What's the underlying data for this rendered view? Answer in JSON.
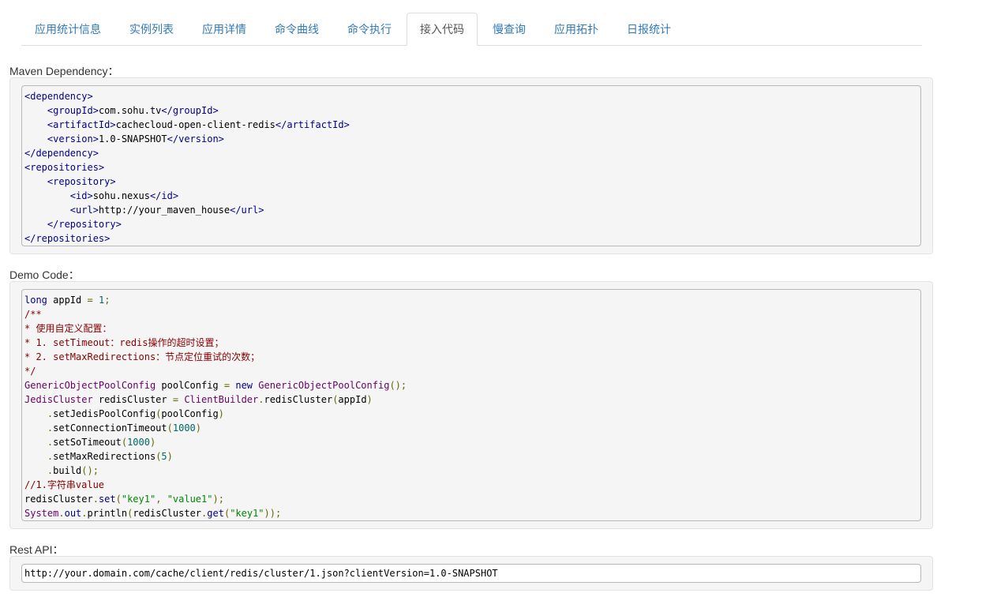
{
  "tabs": [
    {
      "label": "应用统计信息",
      "active": false
    },
    {
      "label": "实例列表",
      "active": false
    },
    {
      "label": "应用详情",
      "active": false
    },
    {
      "label": "命令曲线",
      "active": false
    },
    {
      "label": "命令执行",
      "active": false
    },
    {
      "label": "接入代码",
      "active": true
    },
    {
      "label": "慢查询",
      "active": false
    },
    {
      "label": "应用拓扑",
      "active": false
    },
    {
      "label": "日报统计",
      "active": false
    }
  ],
  "maven": {
    "label": "Maven Dependency：",
    "lines": [
      [
        [
          "tag",
          "<dependency>"
        ]
      ],
      [
        [
          "txt",
          "    "
        ],
        [
          "tag",
          "<groupId>"
        ],
        [
          "txt",
          "com.sohu.tv"
        ],
        [
          "tag",
          "</groupId>"
        ]
      ],
      [
        [
          "txt",
          "    "
        ],
        [
          "tag",
          "<artifactId>"
        ],
        [
          "txt",
          "cachecloud-open-client-redis"
        ],
        [
          "tag",
          "</artifactId>"
        ]
      ],
      [
        [
          "txt",
          "    "
        ],
        [
          "tag",
          "<version>"
        ],
        [
          "txt",
          "1.0-SNAPSHOT"
        ],
        [
          "tag",
          "</version>"
        ]
      ],
      [
        [
          "tag",
          "</dependency>"
        ]
      ],
      [
        [
          "tag",
          "<repositories>"
        ]
      ],
      [
        [
          "txt",
          "    "
        ],
        [
          "tag",
          "<repository>"
        ]
      ],
      [
        [
          "txt",
          "        "
        ],
        [
          "tag",
          "<id>"
        ],
        [
          "txt",
          "sohu.nexus"
        ],
        [
          "tag",
          "</id>"
        ]
      ],
      [
        [
          "txt",
          "        "
        ],
        [
          "tag",
          "<url>"
        ],
        [
          "txt",
          "http://your_maven_house"
        ],
        [
          "tag",
          "</url>"
        ]
      ],
      [
        [
          "txt",
          "    "
        ],
        [
          "tag",
          "</repository>"
        ]
      ],
      [
        [
          "tag",
          "</repositories>"
        ]
      ]
    ]
  },
  "demo": {
    "label": "Demo Code：",
    "lines": [
      [
        [
          "kwd",
          "long"
        ],
        [
          "pln",
          " appId "
        ],
        [
          "pun",
          "="
        ],
        [
          "pln",
          " "
        ],
        [
          "lit",
          "1"
        ],
        [
          "pun",
          ";"
        ]
      ],
      [
        [
          "com",
          "/**"
        ]
      ],
      [
        [
          "com",
          "* 使用自定义配置："
        ]
      ],
      [
        [
          "com",
          "* 1. setTimeout：redis操作的超时设置；"
        ]
      ],
      [
        [
          "com",
          "* 2. setMaxRedirections：节点定位重试的次数；"
        ]
      ],
      [
        [
          "com",
          "*/"
        ]
      ],
      [
        [
          "typ",
          "GenericObjectPoolConfig"
        ],
        [
          "pln",
          " poolConfig "
        ],
        [
          "pun",
          "="
        ],
        [
          "pln",
          " "
        ],
        [
          "kwd",
          "new"
        ],
        [
          "pln",
          " "
        ],
        [
          "typ",
          "GenericObjectPoolConfig"
        ],
        [
          "pun",
          "();"
        ]
      ],
      [
        [
          "typ",
          "JedisCluster"
        ],
        [
          "pln",
          " redisCluster "
        ],
        [
          "pun",
          "="
        ],
        [
          "pln",
          " "
        ],
        [
          "typ",
          "ClientBuilder"
        ],
        [
          "pun",
          "."
        ],
        [
          "pln",
          "redisCluster"
        ],
        [
          "pun",
          "("
        ],
        [
          "pln",
          "appId"
        ],
        [
          "pun",
          ")"
        ]
      ],
      [
        [
          "pln",
          "    "
        ],
        [
          "pun",
          "."
        ],
        [
          "pln",
          "setJedisPoolConfig"
        ],
        [
          "pun",
          "("
        ],
        [
          "pln",
          "poolConfig"
        ],
        [
          "pun",
          ")"
        ]
      ],
      [
        [
          "pln",
          "    "
        ],
        [
          "pun",
          "."
        ],
        [
          "pln",
          "setConnectionTimeout"
        ],
        [
          "pun",
          "("
        ],
        [
          "lit",
          "1000"
        ],
        [
          "pun",
          ")"
        ]
      ],
      [
        [
          "pln",
          "    "
        ],
        [
          "pun",
          "."
        ],
        [
          "pln",
          "setSoTimeout"
        ],
        [
          "pun",
          "("
        ],
        [
          "lit",
          "1000"
        ],
        [
          "pun",
          ")"
        ]
      ],
      [
        [
          "pln",
          "    "
        ],
        [
          "pun",
          "."
        ],
        [
          "pln",
          "setMaxRedirections"
        ],
        [
          "pun",
          "("
        ],
        [
          "lit",
          "5"
        ],
        [
          "pun",
          ")"
        ]
      ],
      [
        [
          "pln",
          "    "
        ],
        [
          "pun",
          "."
        ],
        [
          "pln",
          "build"
        ],
        [
          "pun",
          "();"
        ]
      ],
      [
        [
          "com",
          "//1.字符串value"
        ]
      ],
      [
        [
          "pln",
          "redisCluster"
        ],
        [
          "pun",
          "."
        ],
        [
          "kwd",
          "set"
        ],
        [
          "pun",
          "("
        ],
        [
          "str",
          "\"key1\""
        ],
        [
          "pun",
          ","
        ],
        [
          "pln",
          " "
        ],
        [
          "str",
          "\"value1\""
        ],
        [
          "pun",
          ");"
        ]
      ],
      [
        [
          "typ",
          "System"
        ],
        [
          "pun",
          "."
        ],
        [
          "kwd",
          "out"
        ],
        [
          "pun",
          "."
        ],
        [
          "pln",
          "println"
        ],
        [
          "pun",
          "("
        ],
        [
          "pln",
          "redisCluster"
        ],
        [
          "pun",
          "."
        ],
        [
          "kwd",
          "get"
        ],
        [
          "pun",
          "("
        ],
        [
          "str",
          "\"key1\""
        ],
        [
          "pun",
          "));"
        ]
      ]
    ]
  },
  "rest": {
    "label": "Rest API：",
    "value": "http://your.domain.com/cache/client/redis/cluster/1.json?clientVersion=1.0-SNAPSHOT"
  },
  "colors": {
    "tab_link": "#337ab7",
    "tab_active": "#555555",
    "well_bg": "#f5f5f5",
    "xml_tag": "#000088",
    "comment": "#880000",
    "type": "#660066",
    "literal": "#006666",
    "string": "#008800"
  }
}
